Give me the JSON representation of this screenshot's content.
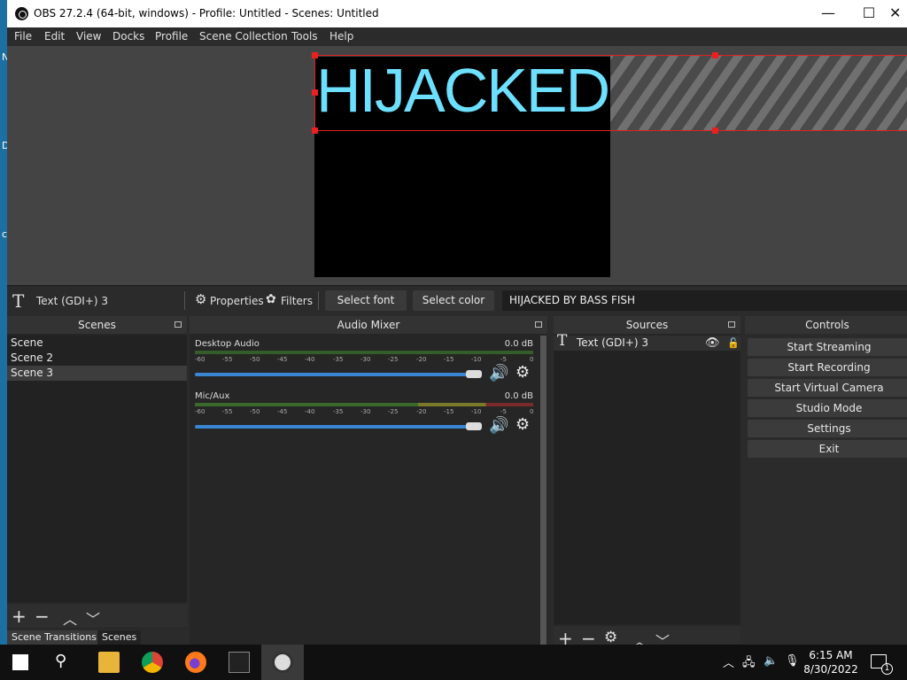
{
  "window": {
    "title": "OBS 27.2.4 (64-bit, windows) - Profile: Untitled - Scenes: Untitled"
  },
  "menu": [
    "File",
    "Edit",
    "View",
    "Docks",
    "Profile",
    "Scene Collection",
    "Tools",
    "Help"
  ],
  "preview": {
    "text": "HIJACKED"
  },
  "source_toolbar": {
    "source_name": "Text (GDI+) 3",
    "properties": "Properties",
    "filters": "Filters",
    "select_font": "Select font",
    "select_color": "Select color",
    "text_value": "HIJACKED BY BASS FISH"
  },
  "scenes": {
    "title": "Scenes",
    "items": [
      "Scene",
      "Scene 2",
      "Scene 3"
    ],
    "selected": "Scene 3"
  },
  "audio_mixer": {
    "title": "Audio Mixer",
    "scale": [
      "-60",
      "-55",
      "-50",
      "-45",
      "-40",
      "-35",
      "-30",
      "-25",
      "-20",
      "-15",
      "-10",
      "-5",
      "0"
    ],
    "channels": [
      {
        "name": "Desktop Audio",
        "db": "0.0 dB",
        "volume": 1.0
      },
      {
        "name": "Mic/Aux",
        "db": "0.0 dB",
        "volume": 1.0
      }
    ]
  },
  "sources": {
    "title": "Sources",
    "items": [
      {
        "name": "Text (GDI+) 3",
        "visible": true,
        "locked": false
      }
    ]
  },
  "controls": {
    "title": "Controls",
    "buttons": [
      "Start Streaming",
      "Start Recording",
      "Start Virtual Camera",
      "Studio Mode",
      "Settings",
      "Exit"
    ]
  },
  "bottom_tabs": [
    "Scene Transitions",
    "Scenes"
  ],
  "taskbar": {
    "time": "6:15 AM",
    "date": "8/30/2022",
    "notification_count": "1"
  }
}
